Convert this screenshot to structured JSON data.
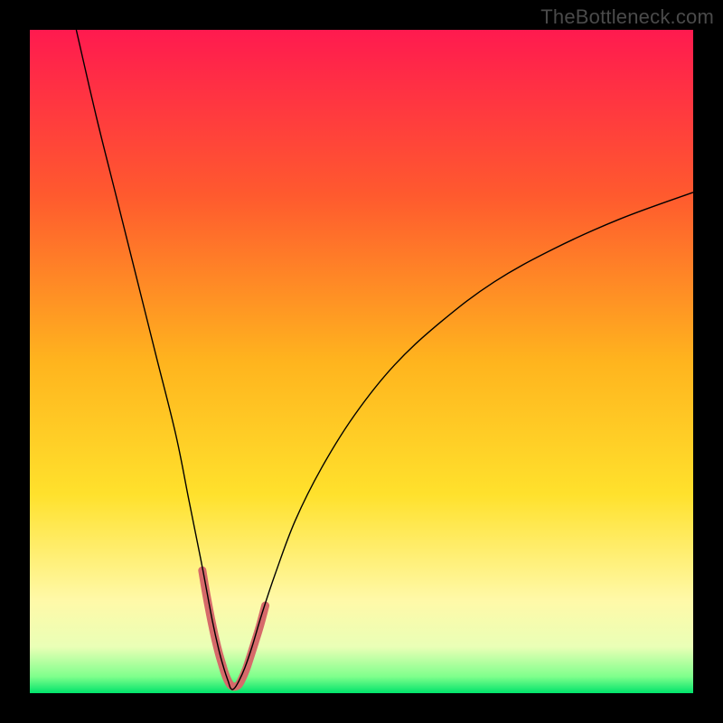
{
  "watermark": "TheBottleneck.com",
  "chart_data": {
    "type": "line",
    "title": "",
    "xlabel": "",
    "ylabel": "",
    "xlim": [
      0,
      100
    ],
    "ylim": [
      0,
      100
    ],
    "grid": false,
    "legend": false,
    "background_gradient": {
      "direction": "vertical",
      "stops": [
        {
          "offset": 0.0,
          "color": "#ff1a4f"
        },
        {
          "offset": 0.25,
          "color": "#ff5a2e"
        },
        {
          "offset": 0.5,
          "color": "#ffb41e"
        },
        {
          "offset": 0.7,
          "color": "#ffe12c"
        },
        {
          "offset": 0.86,
          "color": "#fff9a8"
        },
        {
          "offset": 0.93,
          "color": "#eaffb6"
        },
        {
          "offset": 0.975,
          "color": "#7fff8c"
        },
        {
          "offset": 1.0,
          "color": "#00e36b"
        }
      ]
    },
    "series": [
      {
        "name": "curve",
        "stroke": "#000000",
        "stroke_width": 1.4,
        "x": [
          7,
          10,
          13,
          16,
          19,
          22,
          24,
          26,
          27.5,
          28.5,
          29.3,
          29.9,
          30.3,
          30.8,
          31.5,
          32.4,
          33.5,
          35,
          37,
          40,
          44,
          49,
          55,
          62,
          70,
          79,
          89,
          100
        ],
        "values": [
          100,
          87,
          75,
          63,
          51,
          39,
          29,
          19,
          11,
          6.5,
          3.6,
          1.8,
          0.7,
          0.7,
          1.8,
          3.8,
          7,
          12,
          18,
          26,
          34,
          42,
          49.5,
          56,
          62,
          67,
          71.5,
          75.5
        ]
      },
      {
        "name": "trough-highlight",
        "stroke": "#d66a6a",
        "stroke_width": 9,
        "linecap": "round",
        "x": [
          26.0,
          26.5,
          27.0,
          27.5,
          28.0,
          28.5,
          29.0,
          29.4,
          29.8,
          30.2,
          30.6,
          31.0,
          31.5,
          32.0,
          32.6,
          33.2,
          33.9,
          34.7,
          35.5
        ],
        "values": [
          18.5,
          15.5,
          12.8,
          10.3,
          8.0,
          6.0,
          4.3,
          3.0,
          2.0,
          1.3,
          1.0,
          1.0,
          1.3,
          2.2,
          3.6,
          5.4,
          7.6,
          10.2,
          13.2
        ]
      }
    ]
  }
}
